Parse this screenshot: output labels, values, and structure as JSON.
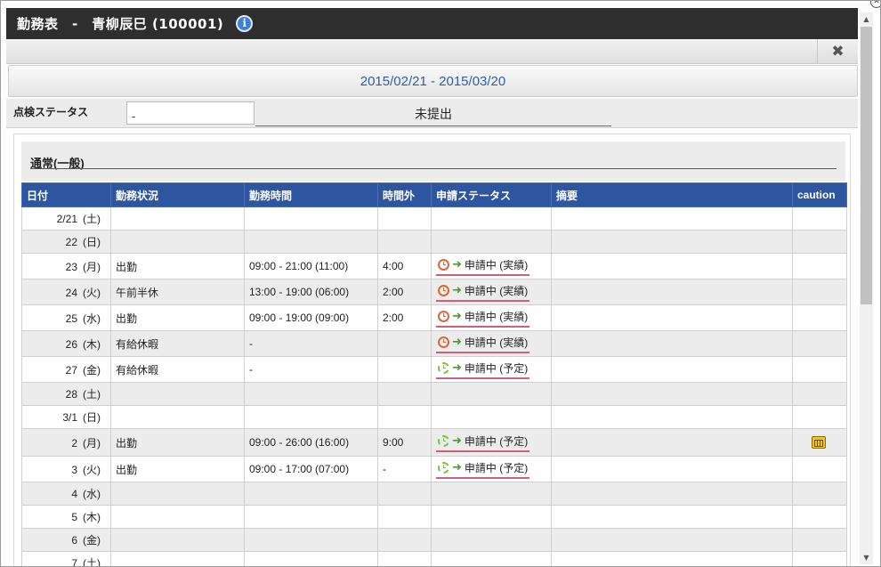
{
  "window": {
    "title": "勤務表　-　青柳辰巳 (100001)",
    "info_icon": "i"
  },
  "toolbar": {
    "close_label": "✖"
  },
  "period": {
    "range": "2015/02/21 - 2015/03/20"
  },
  "status": {
    "label": "点検ステータス",
    "input_value": "-",
    "value": "未提出"
  },
  "section": {
    "title": "通常(一般)"
  },
  "table": {
    "headers": [
      "日付",
      "勤務状況",
      "勤務時間",
      "時間外",
      "申請ステータス",
      "摘要",
      "caution"
    ],
    "rows": [
      {
        "date": "2/21",
        "dow": "(土)",
        "day_type": "sat",
        "work": "",
        "hours": "",
        "overtime": "",
        "request": "",
        "request_kind": "",
        "note": "",
        "caution": false
      },
      {
        "date": "22",
        "dow": "(日)",
        "day_type": "sun",
        "work": "",
        "hours": "",
        "overtime": "",
        "request": "",
        "request_kind": "",
        "note": "",
        "caution": false
      },
      {
        "date": "23",
        "dow": "(月)",
        "day_type": "weekday",
        "work": "出勤",
        "hours": "09:00 - 21:00 (11:00)",
        "overtime": "4:00",
        "request": "申請中 (実績)",
        "request_kind": "actual",
        "note": "",
        "caution": false
      },
      {
        "date": "24",
        "dow": "(火)",
        "day_type": "weekday",
        "work": "午前半休",
        "hours": "13:00 - 19:00 (06:00)",
        "overtime": "2:00",
        "request": "申請中 (実績)",
        "request_kind": "actual",
        "note": "",
        "caution": false
      },
      {
        "date": "25",
        "dow": "(水)",
        "day_type": "weekday",
        "work": "出勤",
        "hours": "09:00 - 19:00 (09:00)",
        "overtime": "2:00",
        "request": "申請中 (実績)",
        "request_kind": "actual",
        "note": "",
        "caution": false
      },
      {
        "date": "26",
        "dow": "(木)",
        "day_type": "weekday",
        "work": "有給休暇",
        "hours": "-",
        "overtime": "",
        "request": "申請中 (実績)",
        "request_kind": "actual",
        "note": "",
        "caution": false
      },
      {
        "date": "27",
        "dow": "(金)",
        "day_type": "weekday",
        "work": "有給休暇",
        "hours": "-",
        "overtime": "",
        "request": "申請中 (予定)",
        "request_kind": "planned",
        "note": "",
        "caution": false
      },
      {
        "date": "28",
        "dow": "(土)",
        "day_type": "sat",
        "work": "",
        "hours": "",
        "overtime": "",
        "request": "",
        "request_kind": "",
        "note": "",
        "caution": false
      },
      {
        "date": "3/1",
        "dow": "(日)",
        "day_type": "sun",
        "work": "",
        "hours": "",
        "overtime": "",
        "request": "",
        "request_kind": "",
        "note": "",
        "caution": false
      },
      {
        "date": "2",
        "dow": "(月)",
        "day_type": "weekday",
        "work": "出勤",
        "hours": "09:00 - 26:00 (16:00)",
        "overtime": "9:00",
        "request": "申請中 (予定)",
        "request_kind": "planned",
        "note": "",
        "caution": true
      },
      {
        "date": "3",
        "dow": "(火)",
        "day_type": "weekday",
        "work": "出勤",
        "hours": "09:00 - 17:00 (07:00)",
        "overtime": "-",
        "request": "申請中 (予定)",
        "request_kind": "planned",
        "note": "",
        "caution": false
      },
      {
        "date": "4",
        "dow": "(水)",
        "day_type": "weekday",
        "work": "",
        "hours": "",
        "overtime": "",
        "request": "",
        "request_kind": "",
        "note": "",
        "caution": false
      },
      {
        "date": "5",
        "dow": "(木)",
        "day_type": "weekday",
        "work": "",
        "hours": "",
        "overtime": "",
        "request": "",
        "request_kind": "",
        "note": "",
        "caution": false
      },
      {
        "date": "6",
        "dow": "(金)",
        "day_type": "weekday",
        "work": "",
        "hours": "",
        "overtime": "",
        "request": "",
        "request_kind": "",
        "note": "",
        "caution": false
      },
      {
        "date": "7",
        "dow": "(土)",
        "day_type": "sat",
        "work": "",
        "hours": "",
        "overtime": "",
        "request": "",
        "request_kind": "",
        "note": "",
        "caution": false
      }
    ]
  },
  "icons": {
    "info": "info-icon",
    "close": "close-icon",
    "clock_actual": "clock-icon",
    "clock_planned": "clock-pending-icon",
    "arrow": "forward-arrow-icon",
    "caution": "caution-icon"
  },
  "colors": {
    "header_blue": "#2e56a0",
    "saturday": "#2b3fae",
    "sunday": "#c42a2a",
    "period_text": "#2f5ea8",
    "titlebar": "#2e2e2e"
  }
}
